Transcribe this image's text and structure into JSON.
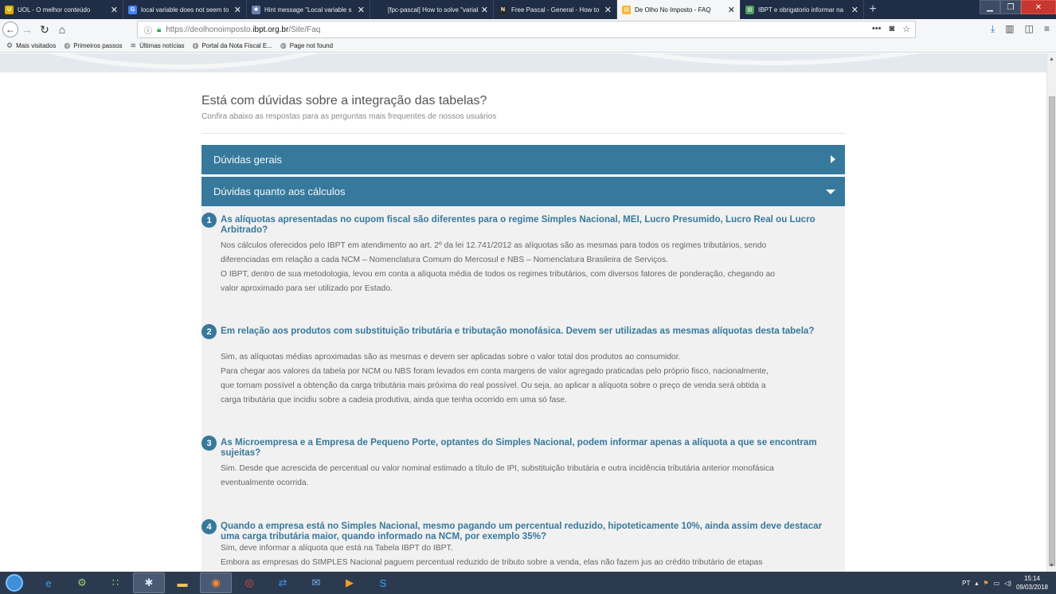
{
  "browser": {
    "tabs": [
      {
        "label": "UOL - O melhor conteúdo",
        "fav_icon": "uol-icon",
        "fav_color": "#e0ac00",
        "fav_glyph": "U",
        "active": false
      },
      {
        "label": "local variable does not seem to",
        "fav_icon": "google-icon",
        "fav_color": "#4285f4",
        "fav_glyph": "G",
        "active": false
      },
      {
        "label": "Hint message \"Local variable s",
        "fav_icon": "lazarus-icon",
        "fav_color": "#6b7fb0",
        "fav_glyph": "✱",
        "active": false
      },
      {
        "label": "[fpc-pascal] How to solve \"variable",
        "fav_icon": "blank-page-icon",
        "fav_color": "transparent",
        "fav_glyph": "",
        "active": false
      },
      {
        "label": "Free Pascal - General - How to",
        "fav_icon": "nabble-icon",
        "fav_color": "#2a2a2a",
        "fav_glyph": "N",
        "active": false
      },
      {
        "label": "De Olho No Imposto - FAQ",
        "fav_icon": "page-icon",
        "fav_color": "#f4b63a",
        "fav_glyph": "▤",
        "active": true
      },
      {
        "label": "IBPT e obrigatorio informar na",
        "fav_icon": "page-icon",
        "fav_color": "#4c9a5a",
        "fav_glyph": "▤",
        "active": false
      }
    ],
    "new_tab": "+",
    "url_prefix": "https://deolhonoimposto.",
    "url_host": "ibpt.org.br",
    "url_path": "/Site/Faq",
    "bookmarks": [
      {
        "label": "Mais visitados",
        "icon": "gear-icon"
      },
      {
        "label": "Primeiros passos",
        "icon": "globe-icon"
      },
      {
        "label": "Últimas notícias",
        "icon": "rss-icon"
      },
      {
        "label": "Portal da Nota Fiscal E...",
        "icon": "globe-icon"
      },
      {
        "label": "Page not found",
        "icon": "globe-icon"
      }
    ]
  },
  "faq": {
    "title": "Está com dúvidas sobre a integração das tabelas?",
    "subtitle": "Confira abaixo as respostas para as perguntas mais frequentes de nossos usuários",
    "sections": [
      {
        "label": "Dúvidas gerais",
        "expanded": false
      },
      {
        "label": "Dúvidas quanto aos cálculos",
        "expanded": true
      }
    ],
    "questions": [
      {
        "number": "1",
        "title": "As alíquotas apresentadas no cupom fiscal são diferentes para o regime Simples Nacional, MEI, Lucro Presumido, Lucro Real ou Lucro Arbitrado?",
        "answer": [
          "Nos cálculos oferecidos pelo IBPT em atendimento ao art. 2º da lei 12.741/2012 as alíquotas são as mesmas para todos os regimes tributários, sendo",
          "diferenciadas em relação a cada NCM – Nomenclatura Comum do Mercosul e NBS – Nomenclatura Brasileira de Serviços.",
          "O IBPT, dentro de sua metodologia, levou em conta a alíquota média de todos os regimes tributários, com diversos fatores de ponderação, chegando ao",
          "valor aproximado para ser utilizado por Estado."
        ]
      },
      {
        "number": "2",
        "title": "Em relação aos produtos com substituição tributária e tributação monofásica. Devem ser utilizadas as mesmas alíquotas desta tabela?",
        "answer": [
          "Sim, as alíquotas médias aproximadas são as mesmas e devem ser aplicadas sobre o valor total dos produtos ao consumidor.",
          "Para chegar aos valores da tabela por NCM ou NBS foram levados em conta margens de valor agregado praticadas pelo próprio fisco, nacionalmente,",
          "que tornam possível a obtenção da carga tributária mais próxima do real possível. Ou seja, ao aplicar a alíquota sobre o preço de venda será obtida a",
          "carga tributária que incidiu sobre a cadeia produtiva, ainda que tenha ocorrido em uma só fase."
        ]
      },
      {
        "number": "3",
        "title": "As Microempresa e a Empresa de Pequeno Porte, optantes do Simples Nacional, podem informar apenas a alíquota a que se encontram sujeitas?",
        "answer": [
          "Sim. Desde que acrescida de percentual ou valor nominal estimado a título de IPI, substituição tributária e outra incidência tributária anterior monofásica",
          "eventualmente ocorrida."
        ]
      },
      {
        "number": "4",
        "title": "Quando a empresa está no Simples Nacional, mesmo pagando um percentual reduzido, hipoteticamente 10%, ainda assim deve destacar uma carga tributária maior, quando informado na NCM, por exemplo 35%?",
        "answer": [
          "Sim, deve informar a alíquota que está na Tabela IBPT do IBPT.",
          "Embora as empresas do SIMPLES Nacional paguem percentual reduzido de tributo sobre a venda, elas não fazem jus ao crédito tributário de etapas"
        ]
      }
    ]
  },
  "taskbar": {
    "apps": [
      {
        "name": "ie-icon",
        "glyph": "e",
        "color": "#3fa0e0"
      },
      {
        "name": "network-icon",
        "glyph": "⚙",
        "color": "#9ad06a"
      },
      {
        "name": "dots-app-icon",
        "glyph": "∷",
        "color": "#6fdc7a"
      },
      {
        "name": "lazarus-app-icon",
        "glyph": "✱",
        "color": "#dfe6f5"
      },
      {
        "name": "folder-icon",
        "glyph": "▬",
        "color": "#f1c75a"
      },
      {
        "name": "firefox-icon",
        "glyph": "◉",
        "color": "#ff8a2a"
      },
      {
        "name": "chrome-icon",
        "glyph": "◎",
        "color": "#e54b3b"
      },
      {
        "name": "teamviewer-icon",
        "glyph": "⇄",
        "color": "#3f8ee6"
      },
      {
        "name": "thunderbird-icon",
        "glyph": "✉",
        "color": "#7ab3e8"
      },
      {
        "name": "media-player-icon",
        "glyph": "▶",
        "color": "#f0a020"
      },
      {
        "name": "skype-icon",
        "glyph": "S",
        "color": "#2ab0ed"
      }
    ],
    "language": "PT",
    "time": "15:14",
    "date": "09/03/2018"
  }
}
